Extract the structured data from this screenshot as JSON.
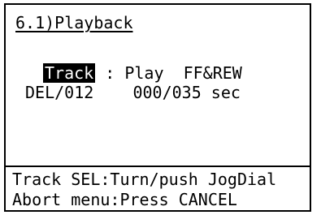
{
  "screen": {
    "title": "6.1)Playback",
    "row1": {
      "highlighted_label": "Track",
      "rest": " : Play  FF&REW"
    },
    "row2": {
      "text": "DEL/012    000/035 sec"
    },
    "help": {
      "line1": "Track SEL:Turn/push JogDial",
      "line2": "Abort menu:Press CANCEL"
    }
  },
  "colors": {
    "background": "#ffffff",
    "foreground": "#000000",
    "highlight_bg": "#000000",
    "highlight_fg": "#ffffff"
  }
}
